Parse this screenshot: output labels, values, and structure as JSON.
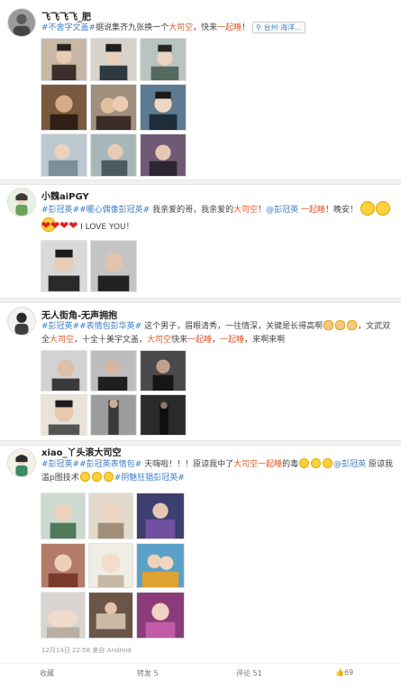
{
  "posts": [
    {
      "username": "飞飞飞飞_肥",
      "tag": "#不舍字文盖#",
      "text_a": "据说集齐九张换一个",
      "hot_a": "大司空",
      "text_b": "，快来",
      "hot_b": "一起睡",
      "text_c": "！",
      "location": "台州·海洋..."
    },
    {
      "username": "小魏aiPGY",
      "tag1": "#彭冠英#",
      "tag2": "#暖心偶像彭冠英#",
      "text_a": "我亲爱的哥，我亲爱的",
      "hot_a": "大司空",
      "text_b": "！",
      "mention": "@彭冠英",
      "hot_b": "一起睡",
      "text_c": "！晚安！",
      "line2": "I LOVE YOU！"
    },
    {
      "username": "无人街角-无声拥抱",
      "tag1": "#彭冠英#",
      "tag2": "#表情包彭华英#",
      "text_a": "这个男子，眉眼清秀，一往情深，关键是长得高啊",
      "text_b": "，文武双全",
      "hot_a": "大司空",
      "text_c": "，十全十美宇文盖，",
      "hot_b": "大司空",
      "text_d": "快来",
      "hot_c": "一起睡",
      "text_e": "，",
      "hot_d": "一起睡",
      "text_f": "，来啊来啊"
    },
    {
      "username": "xiao_丫头滚大司空",
      "tag1": "#彭冠英#",
      "tag2": "#彭冠英表情包#",
      "text_a": "天嗨啦！！！原谅我中了",
      "hot_a": "大司空",
      "hot_b": "一起睡",
      "text_b": "的毒",
      "mention": "@彭冠英",
      "text_c": "原谅我",
      "text_d": "滥p图技术",
      "tag3": "#阴魅狂猖彭冠英#",
      "meta": "12月14日 22:58 来自 Android"
    }
  ],
  "actions": {
    "favorite": "收藏",
    "repost": "转发 5",
    "comment": "评论 51",
    "like": "69"
  },
  "colors": {
    "link": "#3b7dc4",
    "hot": "#e05a2a",
    "divider": "#f2f2f2"
  }
}
